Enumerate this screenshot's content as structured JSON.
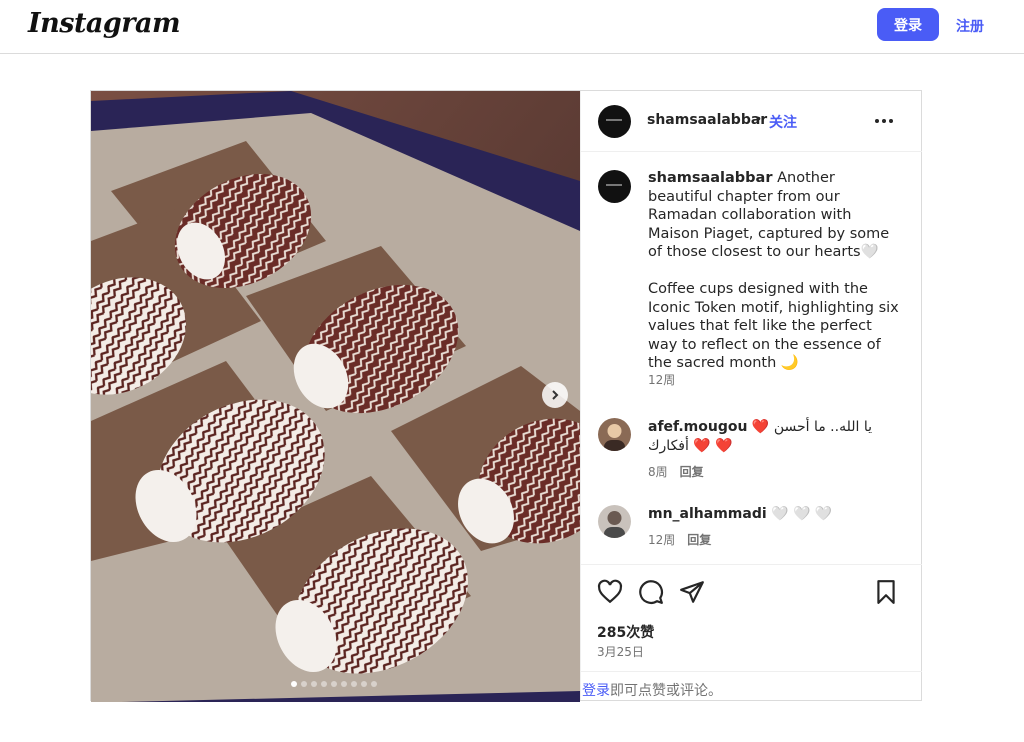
{
  "nav": {
    "logo": "Instagram",
    "login_label": "登录",
    "signup_label": "注册"
  },
  "post": {
    "author": "shamsaalabbar",
    "separator": "•",
    "follow_label": "关注",
    "caption_author": "shamsaalabbar",
    "caption": " Another beautiful chapter from our Ramadan collaboration with Maison Piaget, captured by some of those closest to our hearts🤍\n\nCoffee cups designed with the Iconic Token motif, highlighting six values that felt like the perfect way to reflect on the essence of the sacred month 🌙",
    "caption_time": "12周",
    "comments": [
      {
        "user": "afef.mougou",
        "text": "❤️ يا الله.. ما أحسن أفكارك ❤️ ❤️",
        "time": "8周",
        "reply_label": "回复"
      },
      {
        "user": "mn_alhammadi",
        "text": "🤍 🤍 🤍",
        "time": "12周",
        "reply_label": "回复"
      }
    ],
    "likes": "285次赞",
    "date": "3月25日",
    "login_prompt_link": "登录",
    "login_prompt_rest": "即可点赞或评论。",
    "carousel": {
      "slide_count": 9,
      "active_index": 0
    }
  },
  "icons": [
    "more-icon",
    "heart-icon",
    "comment-icon",
    "share-icon",
    "bookmark-icon",
    "next-arrow-icon"
  ],
  "colors": {
    "accent": "#4a5cf6",
    "border": "#dbdbdb",
    "muted": "#737373",
    "text": "#262626"
  }
}
